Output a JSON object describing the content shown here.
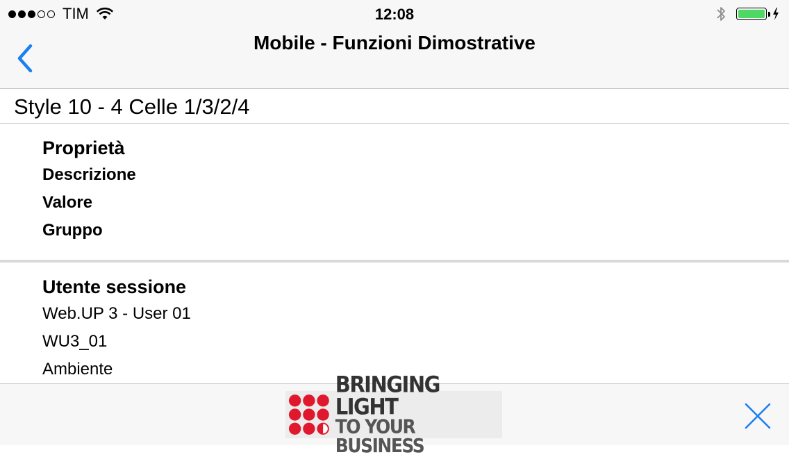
{
  "status_bar": {
    "carrier": "TIM",
    "signal_strength": "3 of 5",
    "time": "12:08",
    "battery_level": "charging",
    "icons": [
      "signal-dots-icon",
      "wifi-icon",
      "bluetooth-icon",
      "battery-icon",
      "charging-bolt-icon"
    ]
  },
  "nav": {
    "title": "Mobile - Funzioni Dimostrative",
    "back_icon": "chevron-left-icon"
  },
  "section": {
    "title": "Style 10 - 4 Celle 1/3/2/4"
  },
  "cards": [
    {
      "title": "Proprietà",
      "lines": [
        "Descrizione",
        "Valore",
        "Gruppo"
      ]
    },
    {
      "title": "Utente sessione",
      "lines": [
        "Web.UP 3 - User 01",
        "WU3_01",
        "Ambiente"
      ]
    }
  ],
  "footer": {
    "logo": {
      "line1": "BRINGING LIGHT",
      "line2": "TO YOUR BUSINESS"
    },
    "close_icon": "close-icon"
  },
  "colors": {
    "accent": "#1a7ff0",
    "bar_background": "#f7f7f7",
    "battery": "#4cd964",
    "logo_red": "#e0182d"
  }
}
